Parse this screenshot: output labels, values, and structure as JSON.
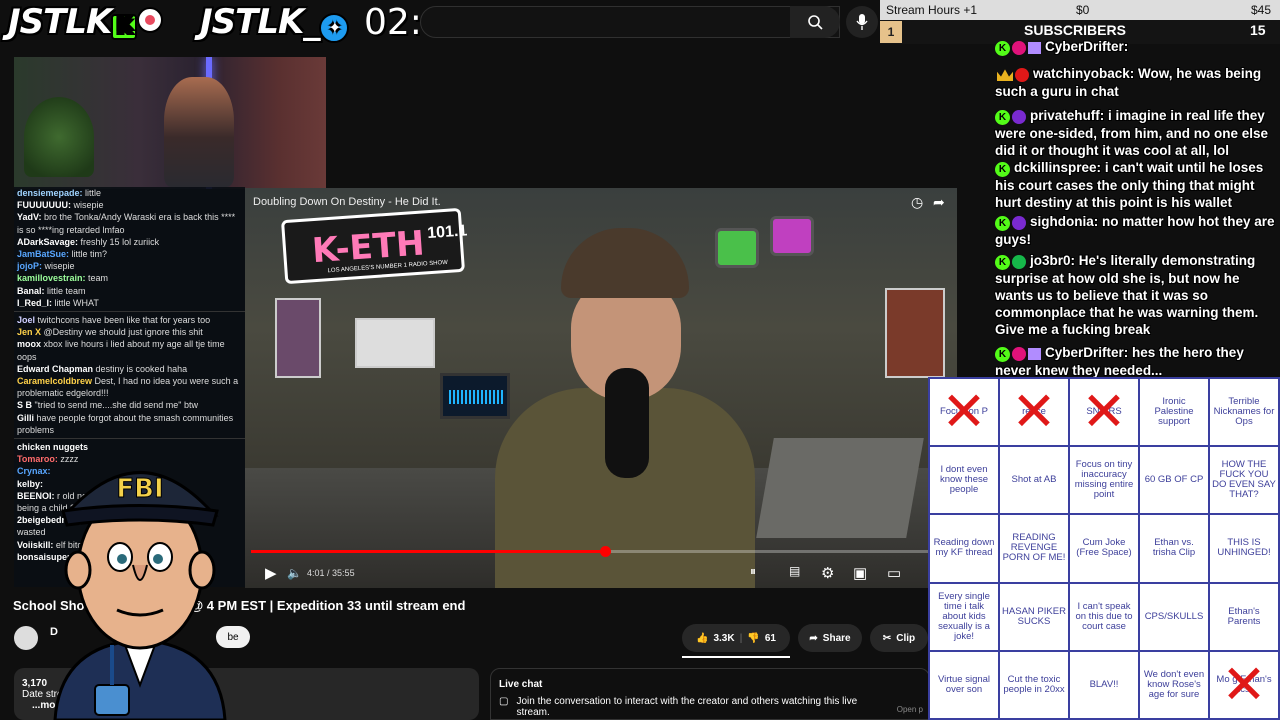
{
  "overlay": {
    "brand1": "JSTLK",
    "brand2": "JSTLK_",
    "timer": "02:47:58",
    "stream_hours_label": "Stream Hours +1",
    "stream_hours_min": "$0",
    "stream_hours_max": "$45",
    "stream_hours_level": "1",
    "subs_label": "SUBSCRIBERS",
    "subs_count": "15"
  },
  "youtube": {
    "search_placeholder": "Search",
    "video_title_overlay": "Doubling Down On Destiny - He Did It.",
    "time_current": "4:01",
    "time_total": "35:55",
    "progress_fraction": 0.506,
    "main_title": "School Sho",
    "main_title_rest": "nse @ 4 PM EST | Expedition 33 until stream end",
    "channel_name": "D",
    "subscribe_label": "be",
    "like_count": "3.3K",
    "dislike_count": "61",
    "share_label": "Share",
    "clip_label": "Clip",
    "desc_views": "3,170",
    "desc_line2": "Date stre",
    "desc_more": "...more",
    "desc_ago": "go",
    "live_chat_title": "Live chat",
    "live_chat_prompt": "Join the conversation to interact with the creator and others watching this live stream.",
    "live_chat_open": "Open p"
  },
  "radio_logo": {
    "name": "K-ETH",
    "freq": "101.1",
    "tagline": "LOS ANGELES'S NUMBER 1 RADIO SHOW",
    "fm": "FM"
  },
  "left_chat": [
    {
      "u": "densiemepade:",
      "t": "little",
      "c": "#9fd3ff"
    },
    {
      "u": "FUUUUUUU:",
      "t": "wisepie",
      "c": "#ffffff"
    },
    {
      "u": "YadV:",
      "t": "bro the Tonka/Andy Waraski era is back this **** is so ****ing retarded lmfao",
      "c": "#ffffff"
    },
    {
      "u": "ADarkSavage:",
      "t": "freshly 15 lol zuriick",
      "c": "#ffffff"
    },
    {
      "u": "JamBatSue:",
      "t": "little tim?",
      "c": "#58a6ff"
    },
    {
      "u": "jojoP:",
      "t": "wisepie",
      "c": "#58a6ff"
    },
    {
      "u": "kamillovestrain:",
      "t": "team",
      "c": "#9cff9c"
    },
    {
      "u": "Banal:",
      "t": "little team",
      "c": "#ffffff"
    },
    {
      "u": "I_Red_I:",
      "t": "little WHAT",
      "c": "#ffffff"
    },
    {
      "u": "Joel",
      "t": "twitchcons have been like that for years too",
      "c": "#cfcfff"
    },
    {
      "u": "Jen X",
      "t": "@Destiny we should just ignore this shit",
      "c": "#ffd24a"
    },
    {
      "u": "moox",
      "t": "xbox live hours i lied about my age all tje time oops",
      "c": "#ffffff"
    },
    {
      "u": "Edward Chapman",
      "t": "destiny is cooked haha",
      "c": "#ffffff"
    },
    {
      "u": "Caramelcoldbrew",
      "t": "Dest, I had no idea you were such a problematic edgelord!!!",
      "c": "#ffd24a"
    },
    {
      "u": "S B",
      "t": "\"tried to send me....she did send me\" btw",
      "c": "#ffffff"
    },
    {
      "u": "Gilli",
      "t": "have people forgot about the smash communities problems",
      "c": "#ffffff"
    },
    {
      "u": "chicken nuggets",
      "t": "",
      "c": "#ffffff"
    },
    {
      "u": "Tomaroo:",
      "t": "zzzz",
      "c": "#ff6b6b"
    },
    {
      "u": "Crynax:",
      "t": "",
      "c": "#58a6ff"
    },
    {
      "u": "kelby:",
      "t": "",
      "c": "#ffffff"
    },
    {
      "u": "BEENOI:",
      "t": "r old not",
      "c": "#ffffff"
    },
    {
      "u": "",
      "t": "being a child ?",
      "c": "#ffffff"
    },
    {
      "u": "2beigebedroo",
      "t": "y 21 youre",
      "c": "#ffffff"
    },
    {
      "u": "",
      "t": "wasted",
      "c": "#ffffff"
    },
    {
      "u": "Voiiskill:",
      "t": "elf bitch?",
      "c": "#ffffff"
    },
    {
      "u": "bonsaisuperst",
      "t": "as you clutch",
      "c": "#ffffff"
    }
  ],
  "right_chat": [
    {
      "u": "CyberDrifter:",
      "t": "",
      "badges": [
        "k",
        "pink",
        "gift"
      ]
    },
    {
      "u": "watchinyoback:",
      "t": "Wow, he was being such a guru in chat",
      "badges": [
        "crown",
        "red"
      ]
    },
    {
      "u": "privatehuff:",
      "t": "i imagine in real life they were one-sided, from him, and no one else did it or thought it was cool at all, lol",
      "badges": [
        "k",
        "purple"
      ]
    },
    {
      "u": "dckillinspree:",
      "t": "i can't wait until he loses his court cases the only thing that might hurt destiny at this point is his wallet",
      "badges": [
        "k"
      ]
    },
    {
      "u": "sighdonia:",
      "t": "no matter how hot they are guys!",
      "badges": [
        "k",
        "purple"
      ]
    },
    {
      "u": "jo3br0:",
      "t": "He's literally demonstrating surprise at how old she is, but now he wants us to believe that it was so commonplace that he was warning them. Give me a fucking break",
      "badges": [
        "k",
        "green"
      ]
    },
    {
      "u": "CyberDrifter:",
      "t": "hes the hero they never knew they needed...",
      "badges": [
        "k",
        "pink",
        "gift"
      ]
    }
  ],
  "bingo": [
    {
      "text": "Focus on P",
      "marked": true
    },
    {
      "text": "ref ce",
      "marked": true
    },
    {
      "text": "SN ERS",
      "marked": true
    },
    {
      "text": "Ironic Palestine support",
      "marked": false
    },
    {
      "text": "Terrible Nicknames for Ops",
      "marked": false
    },
    {
      "text": "I dont even know these people",
      "marked": false
    },
    {
      "text": "Shot at AB",
      "marked": false
    },
    {
      "text": "Focus on tiny inaccuracy missing entire point",
      "marked": false
    },
    {
      "text": "60 GB OF CP",
      "marked": false
    },
    {
      "text": "HOW THE FUCK YOU DO EVEN SAY THAT?",
      "marked": false
    },
    {
      "text": "Reading down my KF thread",
      "marked": false
    },
    {
      "text": "READING REVENGE PORN OF ME!",
      "marked": false
    },
    {
      "text": "Cum Joke (Free Space)",
      "marked": false
    },
    {
      "text": "Ethan vs. trisha Clip",
      "marked": false
    },
    {
      "text": "THIS IS UNHINGED!",
      "marked": false
    },
    {
      "text": "Every single time i talk about kids sexually is a joke!",
      "marked": false
    },
    {
      "text": "HASAN PIKER SUCKS",
      "marked": false
    },
    {
      "text": "I can't speak on this due to court case",
      "marked": false
    },
    {
      "text": "CPS/SKULLS",
      "marked": false
    },
    {
      "text": "Ethan's Parents",
      "marked": false
    },
    {
      "text": "Virtue signal over son",
      "marked": false
    },
    {
      "text": "Cut the toxic people in 20xx",
      "marked": false
    },
    {
      "text": "BLAV!!",
      "marked": false
    },
    {
      "text": "We don't even know Rose's age for sure",
      "marked": false
    },
    {
      "text": "Mo g Ethan's ics",
      "marked": true
    }
  ],
  "fbi_badge": "FBI",
  "colors": {
    "accent_red": "#ff0000",
    "kick_green": "#53fc18",
    "bingo_border": "#3a3fa0",
    "bingo_text": "#3d3f9a"
  }
}
